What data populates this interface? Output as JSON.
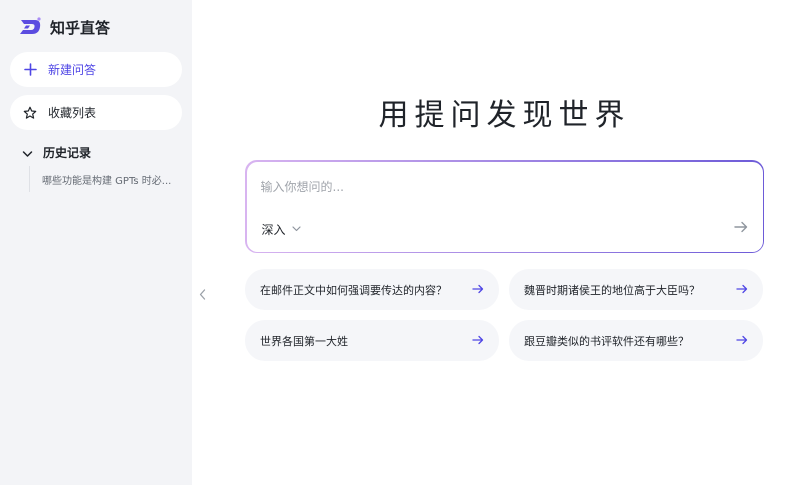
{
  "app": {
    "name": "知乎直答"
  },
  "sidebar": {
    "new_chat_label": "新建问答",
    "favorites_label": "收藏列表",
    "history_label": "历史记录",
    "history_items": [
      "哪些功能是构建 GPTs 时必..."
    ]
  },
  "main": {
    "headline": "用提问发现世界",
    "input": {
      "placeholder": "输入你想问的...",
      "value": ""
    },
    "mode_label": "深入",
    "suggestions": [
      "在邮件正文中如何强调要传达的内容？",
      "魏晋时期诸侯王的地位高于大臣吗？",
      "世界各国第一大姓",
      "跟豆瓣类似的书评软件还有哪些？"
    ]
  },
  "colors": {
    "accent": "#4f46e5",
    "sidebar_bg": "#f3f4f7",
    "suggestion_bg": "#f5f6f9"
  }
}
